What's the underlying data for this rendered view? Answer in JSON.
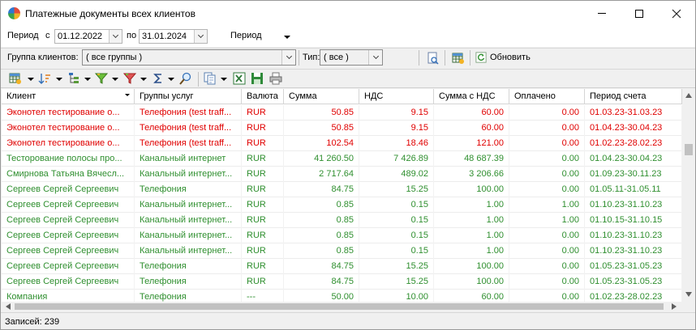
{
  "window": {
    "title": "Платежные документы всех клиентов"
  },
  "filters": {
    "period_label": "Период",
    "from_label": "с",
    "date_from": "01.12.2022",
    "to_label": "по",
    "date_to": "31.01.2024",
    "period_dropdown_label": "Период",
    "group_label": "Группа клиентов:",
    "group_value": "( все группы )",
    "type_label": "Тип:",
    "type_value": "( все )",
    "refresh_label": "Обновить"
  },
  "toolbar": {
    "icons": [
      "grid-settings-icon",
      "sort-icon",
      "tree-icon",
      "filter-icon",
      "filter-clear-icon",
      "sum-icon",
      "find-icon",
      "copy-icon",
      "export-excel-icon",
      "save-icon",
      "print-icon"
    ]
  },
  "table": {
    "columns": [
      "Клиент",
      "Группы услуг",
      "Валюта",
      "Сумма",
      "НДС",
      "Сумма с НДС",
      "Оплачено",
      "Период счета"
    ],
    "rows": [
      {
        "color": "red",
        "cells": [
          "Эконотел тестирование о...",
          "Телефония (test traff...",
          "RUR",
          "50.85",
          "9.15",
          "60.00",
          "0.00",
          "01.03.23-31.03.23"
        ]
      },
      {
        "color": "red",
        "cells": [
          "Эконотел тестирование о...",
          "Телефония (test traff...",
          "RUR",
          "50.85",
          "9.15",
          "60.00",
          "0.00",
          "01.04.23-30.04.23"
        ]
      },
      {
        "color": "red",
        "cells": [
          "Эконотел тестирование о...",
          "Телефония (test traff...",
          "RUR",
          "102.54",
          "18.46",
          "121.00",
          "0.00",
          "01.02.23-28.02.23"
        ]
      },
      {
        "color": "green",
        "cells": [
          "Тесторование полосы про...",
          "Канальный интернет",
          "RUR",
          "41 260.50",
          "7 426.89",
          "48 687.39",
          "0.00",
          "01.04.23-30.04.23"
        ]
      },
      {
        "color": "green",
        "cells": [
          "Смирнова Татьяна Вячесл...",
          "Канальный интернет...",
          "RUR",
          "2 717.64",
          "489.02",
          "3 206.66",
          "0.00",
          "01.09.23-30.11.23"
        ]
      },
      {
        "color": "green",
        "cells": [
          "Сергеев Сергей Сергеевич",
          "Телефония",
          "RUR",
          "84.75",
          "15.25",
          "100.00",
          "0.00",
          "01.05.11-31.05.11"
        ]
      },
      {
        "color": "green",
        "cells": [
          "Сергеев Сергей Сергеевич",
          "Канальный интернет...",
          "RUR",
          "0.85",
          "0.15",
          "1.00",
          "1.00",
          "01.10.23-31.10.23"
        ]
      },
      {
        "color": "green",
        "cells": [
          "Сергеев Сергей Сергеевич",
          "Канальный интернет...",
          "RUR",
          "0.85",
          "0.15",
          "1.00",
          "1.00",
          "01.10.15-31.10.15"
        ]
      },
      {
        "color": "green",
        "cells": [
          "Сергеев Сергей Сергеевич",
          "Канальный интернет...",
          "RUR",
          "0.85",
          "0.15",
          "1.00",
          "0.00",
          "01.10.23-31.10.23"
        ]
      },
      {
        "color": "green",
        "cells": [
          "Сергеев Сергей Сергеевич",
          "Канальный интернет...",
          "RUR",
          "0.85",
          "0.15",
          "1.00",
          "0.00",
          "01.10.23-31.10.23"
        ]
      },
      {
        "color": "green",
        "cells": [
          "Сергеев Сергей Сергеевич",
          "Телефония",
          "RUR",
          "84.75",
          "15.25",
          "100.00",
          "0.00",
          "01.05.23-31.05.23"
        ]
      },
      {
        "color": "green",
        "cells": [
          "Сергеев Сергей Сергеевич",
          "Телефония",
          "RUR",
          "84.75",
          "15.25",
          "100.00",
          "0.00",
          "01.05.23-31.05.23"
        ]
      },
      {
        "color": "green",
        "cells": [
          "Компания",
          "Телефония",
          "---",
          "50.00",
          "10.00",
          "60.00",
          "0.00",
          "01.02.23-28.02.23"
        ]
      }
    ]
  },
  "status": {
    "records": "Записей: 239"
  },
  "colors": {
    "red": "#e00000",
    "green": "#2f8f2f"
  }
}
